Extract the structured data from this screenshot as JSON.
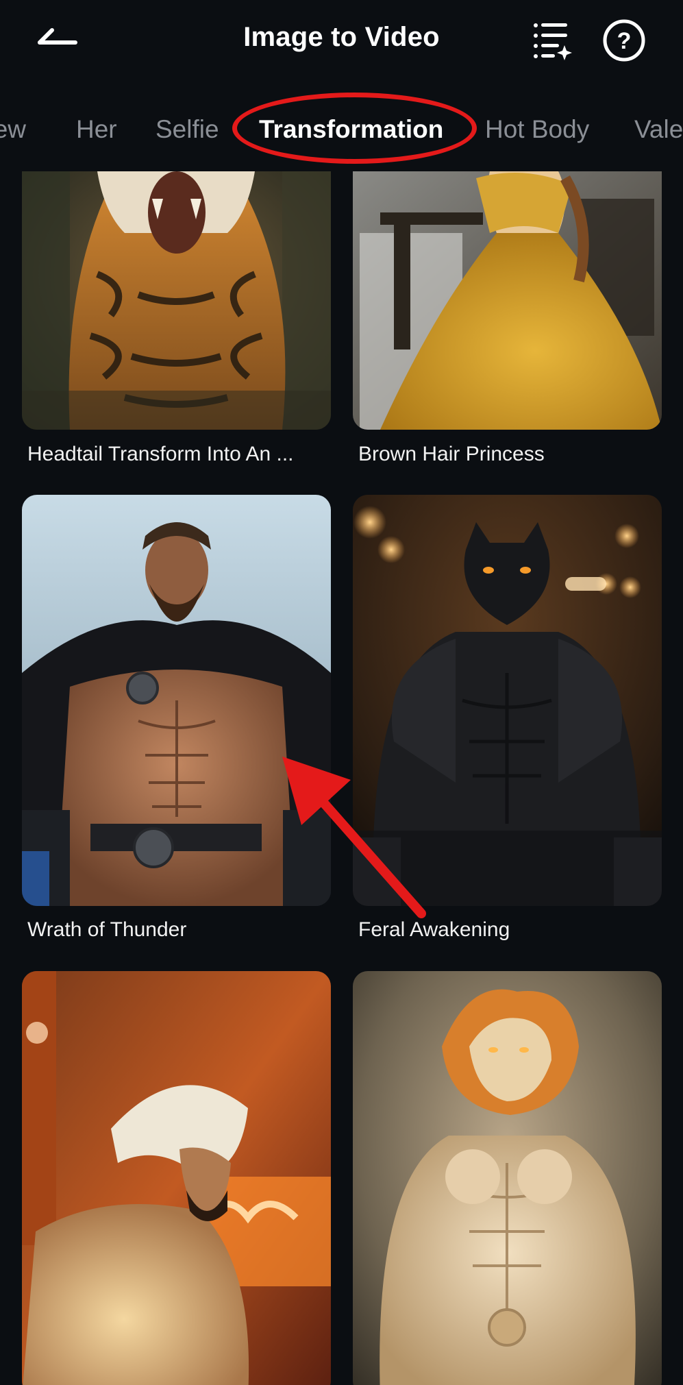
{
  "header": {
    "title": "Image to Video",
    "back_icon": "back-arrow-icon",
    "list_icon": "sparkle-list-icon",
    "help_icon": "help-circle-icon",
    "help_glyph": "?"
  },
  "tabs": [
    {
      "label": "New"
    },
    {
      "label": "Her"
    },
    {
      "label": "Selfie"
    },
    {
      "label": "Transformation",
      "active": true
    },
    {
      "label": "Hot Body"
    },
    {
      "label": "Valentine"
    }
  ],
  "cards": [
    {
      "label": "Headtail Transform Into An ..."
    },
    {
      "label": "Brown Hair Princess"
    },
    {
      "label": "Wrath of Thunder"
    },
    {
      "label": "Feral Awakening"
    },
    {
      "label": ""
    },
    {
      "label": ""
    }
  ],
  "colors": {
    "background": "#0b0e12",
    "tab_inactive": "#8b8f96",
    "tab_active": "#ffffff",
    "annotation_red": "#e41a1a"
  }
}
